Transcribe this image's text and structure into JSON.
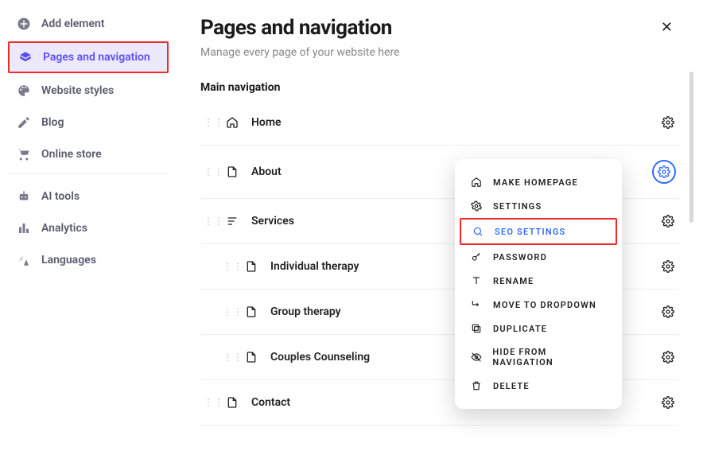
{
  "sidebar": {
    "items": [
      {
        "label": "Add element"
      },
      {
        "label": "Pages and navigation"
      },
      {
        "label": "Website styles"
      },
      {
        "label": "Blog"
      },
      {
        "label": "Online store"
      },
      {
        "label": "AI tools"
      },
      {
        "label": "Analytics"
      },
      {
        "label": "Languages"
      }
    ]
  },
  "panel": {
    "title": "Pages and navigation",
    "subtitle": "Manage every page of your website here",
    "section_label": "Main navigation"
  },
  "nav": {
    "rows": [
      {
        "label": "Home"
      },
      {
        "label": "About"
      },
      {
        "label": "Services"
      },
      {
        "label": "Individual therapy"
      },
      {
        "label": "Group therapy"
      },
      {
        "label": "Couples Counseling"
      },
      {
        "label": "Contact"
      }
    ]
  },
  "menu": {
    "items": [
      {
        "label": "Make homepage"
      },
      {
        "label": "Settings"
      },
      {
        "label": "SEO settings"
      },
      {
        "label": "Password"
      },
      {
        "label": "Rename"
      },
      {
        "label": "Move to dropdown"
      },
      {
        "label": "Duplicate"
      },
      {
        "label": "Hide from navigation"
      },
      {
        "label": "Delete"
      }
    ]
  }
}
